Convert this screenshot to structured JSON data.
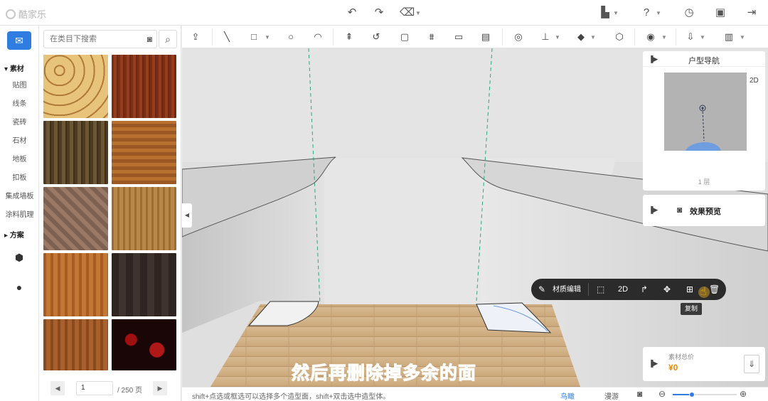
{
  "app": {
    "title": "酷家乐"
  },
  "topbar": {
    "icons": [
      "undo-icon",
      "redo-icon",
      "eraser-icon",
      "save-menu-icon",
      "help-icon",
      "history-icon",
      "floppy-icon",
      "exit-icon"
    ]
  },
  "leftnav": {
    "section_material": "素材",
    "items": [
      "贴图",
      "线条",
      "瓷砖",
      "石材",
      "地板",
      "扣板",
      "集成墙板",
      "涂料肌理"
    ],
    "section_scheme": "方案"
  },
  "material_panel": {
    "search_placeholder": "在类目下搜索",
    "page_current": "1",
    "page_total": "/ 250 页",
    "tiles": [
      {
        "name": "tile-ornate-parquet",
        "color": "#d9b070"
      },
      {
        "name": "tile-red-oak",
        "color": "#8a3a1c"
      },
      {
        "name": "tile-dark-walnut",
        "color": "#5e4a2a"
      },
      {
        "name": "tile-amber-plank",
        "color": "#a9642a"
      },
      {
        "name": "tile-weathered-pine",
        "color": "#8a6b57"
      },
      {
        "name": "tile-honey-oak",
        "color": "#a8773c"
      },
      {
        "name": "tile-orange-teak",
        "color": "#b56a2a"
      },
      {
        "name": "tile-ebony-square",
        "color": "#3a302c"
      },
      {
        "name": "tile-cherry-strip",
        "color": "#9a5424"
      },
      {
        "name": "tile-black-red-pattern",
        "color": "#2a0a0a"
      }
    ]
  },
  "right_panel": {
    "nav_title": "户型导航",
    "badge_2d": "2D",
    "floor_label": "1 层",
    "preview_label": "效果预览",
    "price_label": "素材总价",
    "price_value": "¥0"
  },
  "context_toolbar": {
    "edit_label": "材质编辑",
    "label_2d": "2D",
    "tooltip": "复制"
  },
  "subtitle": "然后再删除掉多余的面",
  "statusbar": {
    "hint": "shift+点选或框选可以选择多个造型面，shift+双击选中造型体。",
    "mode_bird": "鸟瞰",
    "mode_walk": "漫游",
    "zoom_level": 0.3
  },
  "colors": {
    "accent": "#2f7de1",
    "price": "#f08a00",
    "subtitle": "#3b8dff"
  }
}
